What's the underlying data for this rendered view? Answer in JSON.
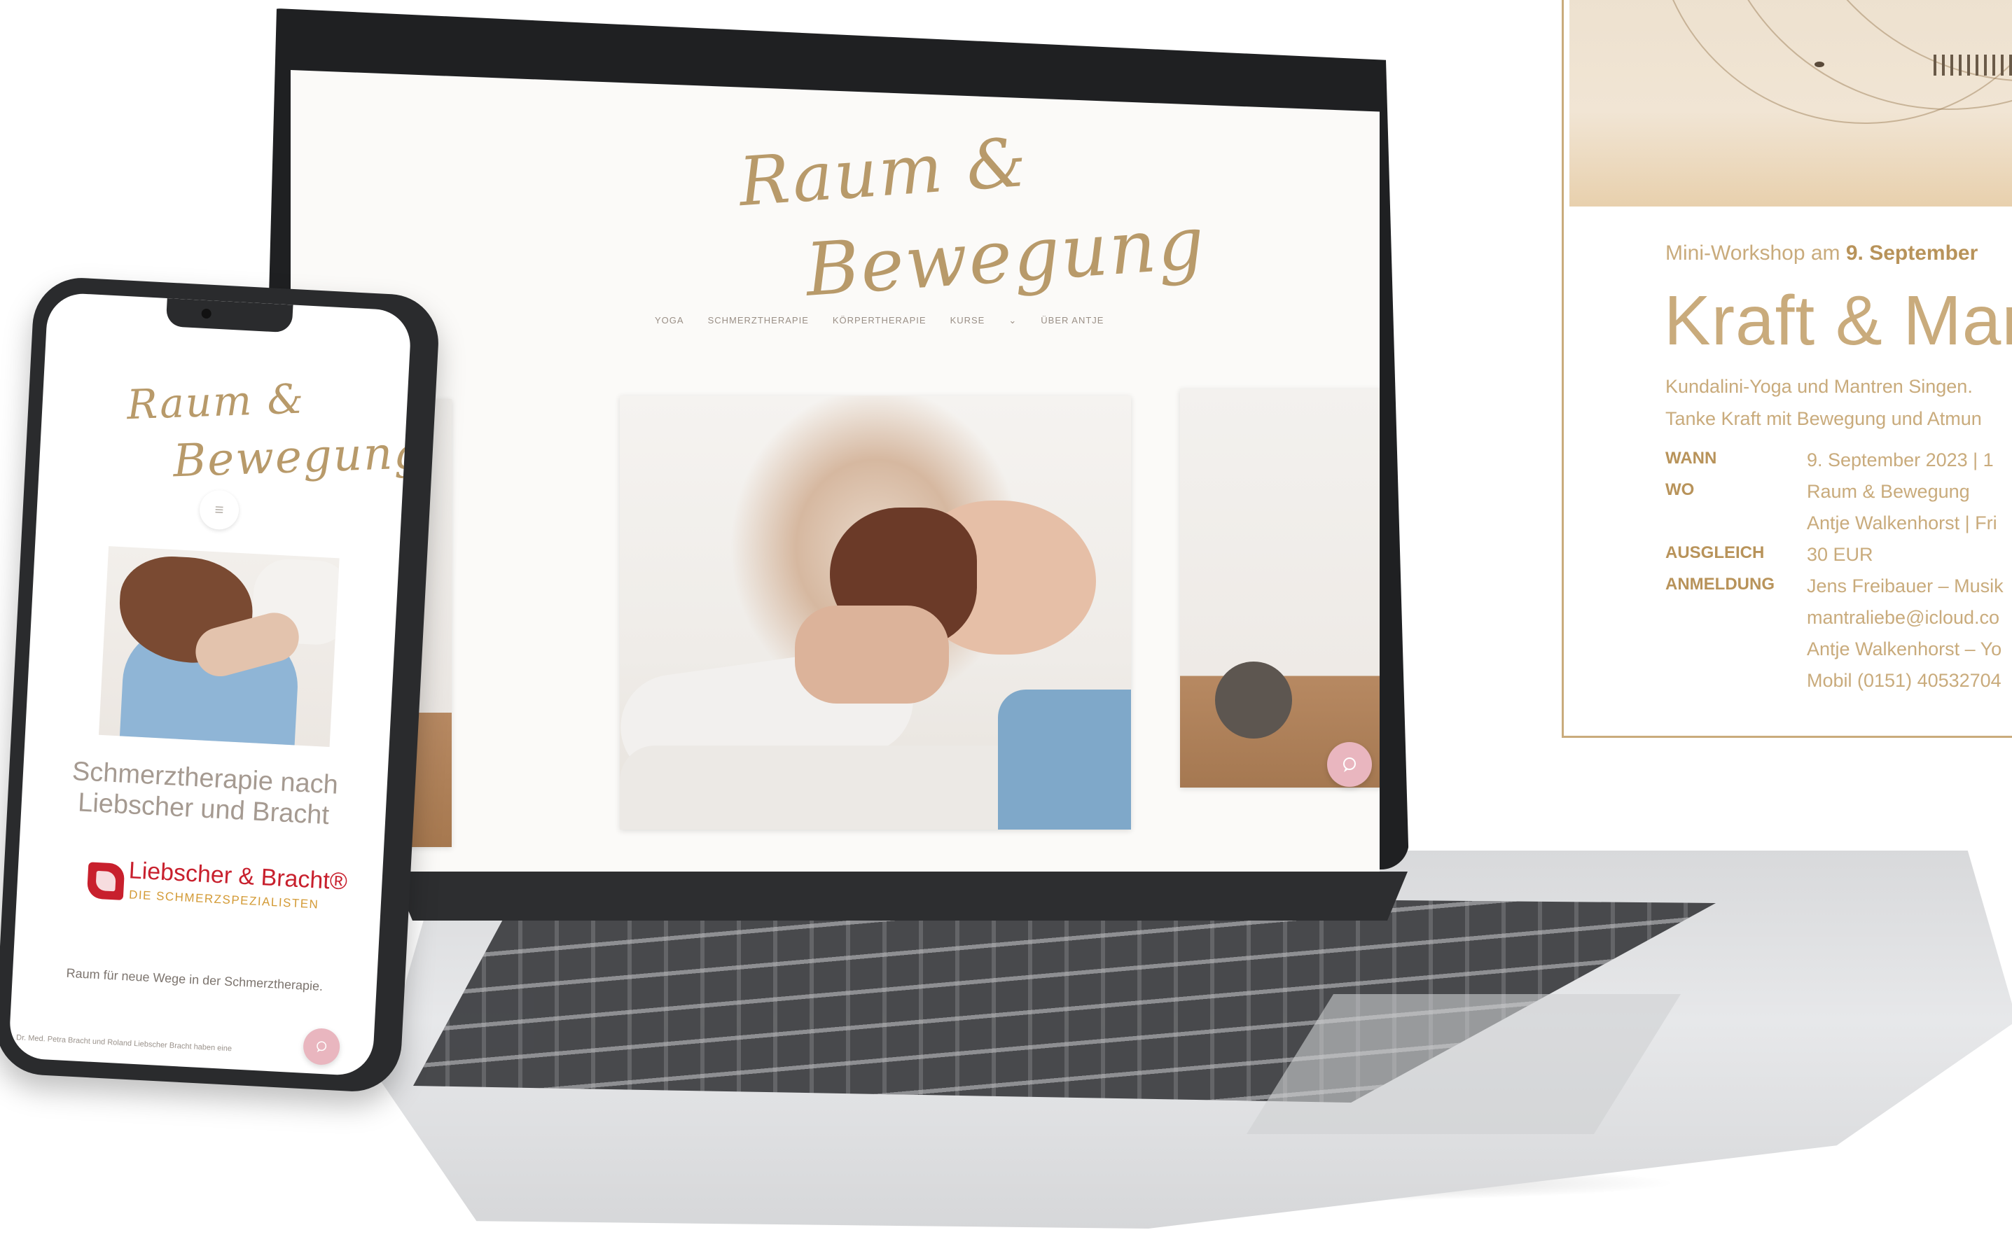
{
  "laptop": {
    "site": {
      "logo_line1": "Raum &",
      "logo_line2": "Bewegung",
      "nav": [
        "YOGA",
        "SCHMERZTHERAPIE",
        "KÖRPERTHERAPIE",
        "KURSE",
        "⌄",
        "ÜBER ANTJE"
      ],
      "chat_icon": "chat-bubble-icon"
    }
  },
  "phone": {
    "logo_line1": "Raum &",
    "logo_line2": "Bewegung",
    "menu_icon": "≡",
    "heading": "Schmerztherapie nach Liebscher und Bracht",
    "brand_name": "Liebscher & Bracht®",
    "brand_sub": "DIE SCHMERZSPEZIALISTEN",
    "tagline": "Raum für neue Wege in der Schmerztherapie.",
    "footer_text": "Dr. Med. Petra Bracht und Roland Liebscher Bracht haben eine",
    "chat_icon": "chat-bubble-icon"
  },
  "workshop": {
    "eyebrow_prefix": "Mini-Workshop am ",
    "eyebrow_date": "9. September",
    "title": "Kraft & Mant",
    "desc_line1": "Kundalini-Yoga und Mantren Singen.",
    "desc_line2": "Tanke Kraft mit Bewegung und Atmun",
    "details": [
      {
        "label": "WANN",
        "values": [
          "9. September 2023 | 1"
        ]
      },
      {
        "label": "WO",
        "values": [
          "Raum & Bewegung",
          "Antje Walkenhorst | Fri"
        ]
      },
      {
        "label": "AUSGLEICH",
        "values": [
          "30 EUR"
        ]
      },
      {
        "label": "ANMELDUNG",
        "values": [
          "Jens Freibauer – Musik",
          "mantraliebe@icloud.co",
          "Antje Walkenhorst – Yo",
          "Mobil (0151) 40532704"
        ]
      }
    ]
  },
  "colors": {
    "gold": "#c9ab7c",
    "gold_dark": "#b8935a",
    "chat_pink": "#e9b6bf",
    "brand_red": "#c8202d",
    "brand_orange": "#d39a35"
  }
}
